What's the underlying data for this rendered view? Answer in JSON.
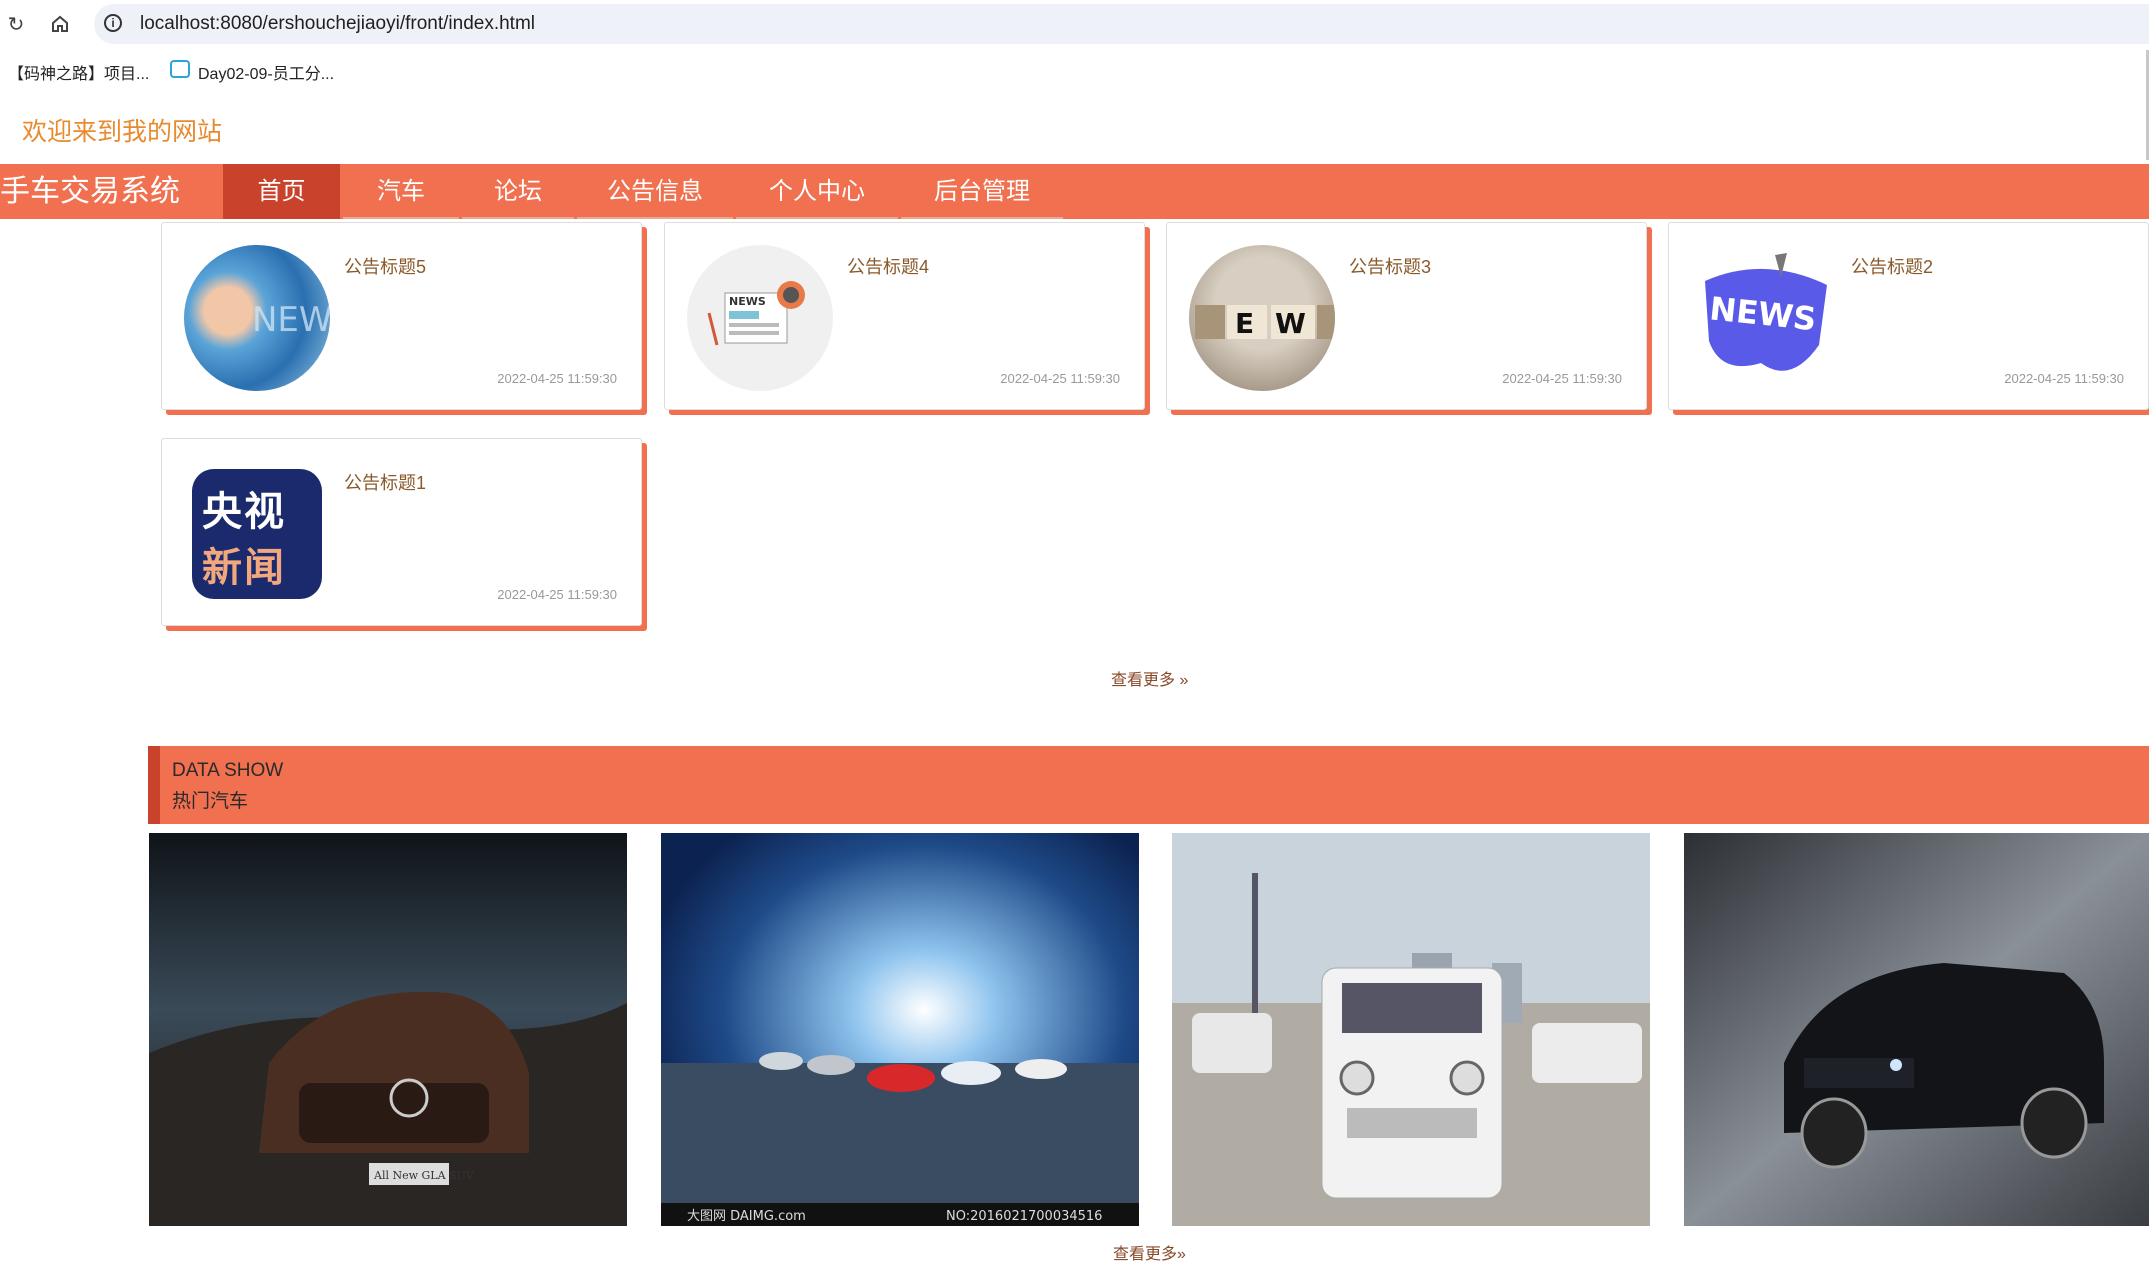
{
  "browser": {
    "url": "localhost:8080/ershouchejiaoyi/front/index.html",
    "bookmarks": [
      "【码神之路】项目...",
      "Day02-09-员工分..."
    ]
  },
  "site": {
    "welcome": "欢迎来到我的网站",
    "brand": "手车交易系统",
    "nav": [
      "首页",
      "汽车",
      "论坛",
      "公告信息",
      "个人中心",
      "后台管理"
    ],
    "active_nav": "首页",
    "accent_color": "#f07050"
  },
  "notices": [
    {
      "title": "公告标题5",
      "date": "2022-04-25 11:59:30",
      "thumb": "globe-news-image"
    },
    {
      "title": "公告标题4",
      "date": "2022-04-25 11:59:30",
      "thumb": "newspaper-news-image"
    },
    {
      "title": "公告标题3",
      "date": "2022-04-25 11:59:30",
      "thumb": "letter-blocks-news-image"
    },
    {
      "title": "公告标题2",
      "date": "2022-04-25 11:59:30",
      "thumb": "blue-news-3d-image"
    },
    {
      "title": "公告标题1",
      "date": "2022-04-25 11:59:30",
      "thumb": "cctv-news-logo"
    }
  ],
  "notice_more": "查看更多 »",
  "section": {
    "en": "DATA SHOW",
    "zh": "热门汽车"
  },
  "cars": [
    {
      "caption": "All New GLA SUV"
    },
    {
      "caption_left": "大图网 DAIMG.com",
      "caption_right": "NO:20160217000345​16"
    },
    {
      "caption": ""
    },
    {
      "caption": ""
    }
  ],
  "cars_more": "查看更多»",
  "cctv_logo": [
    "央视",
    "新闻"
  ],
  "news_word": "NEWS",
  "ew_blocks": [
    "E",
    "W"
  ]
}
